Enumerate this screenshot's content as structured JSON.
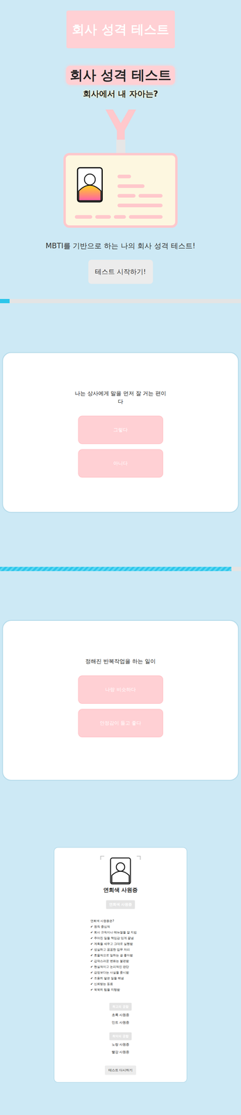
{
  "header": {
    "title": "회사 성격 테스트"
  },
  "intro": {
    "title": "회사 성격 테스트",
    "subtitle": "회사에서 내 자아는?",
    "description": "MBTI를 기반으로 하는 나의 회사 성격 테스트!",
    "start_button": "테스트 시작하기!"
  },
  "questions": [
    {
      "progress": 0.04,
      "striped": false,
      "question": "나는 상사에게 말을 먼저 잘 거는 편이다",
      "answers": [
        "그렇다",
        "아니다"
      ]
    },
    {
      "progress": 0.96,
      "striped": true,
      "question": "정해진 반복작업을 하는 일이",
      "answers": [
        "나랑 비슷하다",
        "안정감이 들고 좋다"
      ]
    }
  ],
  "result": {
    "title": "연회색 사원증",
    "badge": "연회색 사원증",
    "heading": "연회색 사원증은?",
    "check_mark": "✔",
    "traits": [
      "원칙 중심적",
      "회사 규칙이나 매뉴얼을 잘 지킴",
      "주어진 일을 책임감 있게 끝냄",
      "계획을 세우고 그대로 실행함",
      "성실하고 꼼꼼한 업무 처리",
      "효율적으로 일하는 걸 좋아함",
      "갑작스러운 변화는 불편함",
      "현실적이고 논리적인 판단",
      "감정보다는 사실을 중시함",
      "조용히 맡은 일을 해냄",
      "신뢰받는 동료",
      "묵묵히 팀을 지탱함"
    ],
    "best": {
      "label": "최고의 궁합",
      "items": [
        "초록 사원증",
        "민트 사원증"
      ]
    },
    "worst": {
      "label": "최악의 궁합",
      "items": [
        "노랑 사원증",
        "빨강 사원증"
      ]
    },
    "retry_button": "테스트 다시하기"
  }
}
